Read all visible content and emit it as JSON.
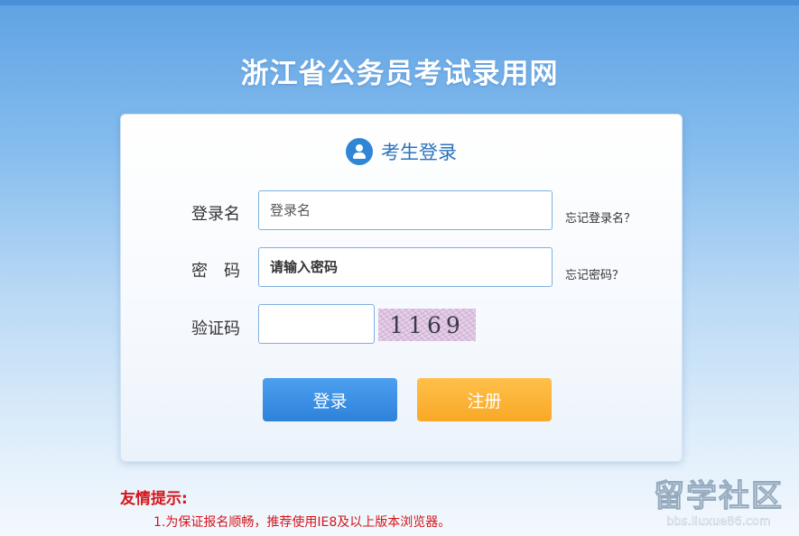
{
  "site_title": "浙江省公务员考试录用网",
  "login_card": {
    "title": "考生登录",
    "username": {
      "label": "登录名",
      "placeholder": "登录名",
      "forgot": "忘记登录名？"
    },
    "password": {
      "label": "密　码",
      "placeholder": "请输入密码",
      "forgot": "忘记密码？"
    },
    "captcha": {
      "label": "验证码",
      "value": "",
      "image_text": "1169"
    },
    "login_button": "登录",
    "register_button": "注册"
  },
  "tips": {
    "title": "友情提示:",
    "items": [
      "1.为保证报名顺畅，推荐使用IE8及以上版本浏览器。"
    ]
  },
  "watermark": {
    "main": "留学社区",
    "url": "bbs.liuxue86.com"
  },
  "colors": {
    "accent": "#2f86d6",
    "login_button": "#3a8fe3",
    "register_button": "#fbb23a",
    "tip_red": "#d4151b"
  },
  "icons": {
    "user": "user-circle-icon"
  }
}
